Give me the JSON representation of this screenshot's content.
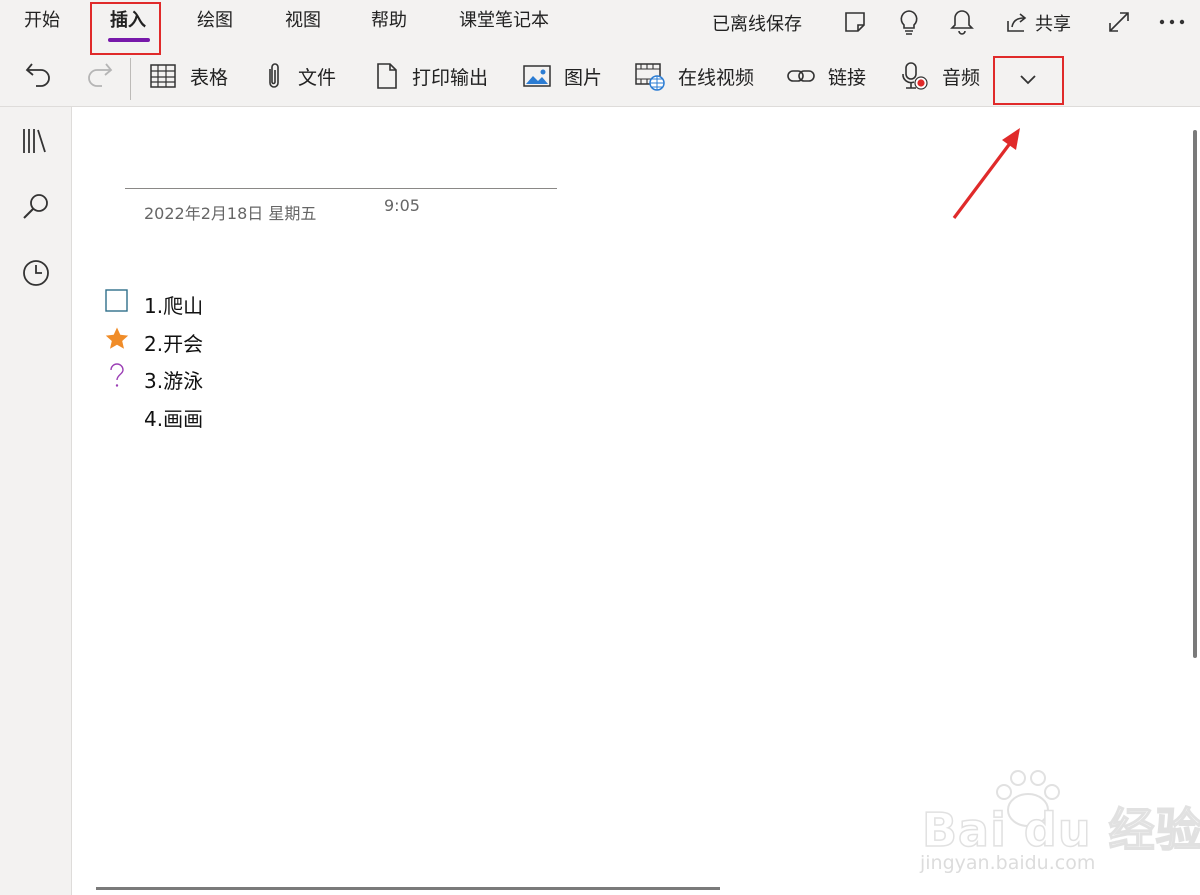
{
  "ribbon": {
    "tabs": [
      {
        "label": "开始"
      },
      {
        "label": "插入"
      },
      {
        "label": "绘图"
      },
      {
        "label": "视图"
      },
      {
        "label": "帮助"
      },
      {
        "label": "课堂笔记本"
      }
    ],
    "active_tab": "插入",
    "status_text": "已离线保存",
    "share_label": "共享",
    "tools": [
      {
        "label": "表格",
        "icon": "table-icon"
      },
      {
        "label": "文件",
        "icon": "paperclip-icon"
      },
      {
        "label": "打印输出",
        "icon": "document-icon"
      },
      {
        "label": "图片",
        "icon": "picture-icon"
      },
      {
        "label": "在线视频",
        "icon": "online-video-icon"
      },
      {
        "label": "链接",
        "icon": "link-icon"
      },
      {
        "label": "音频",
        "icon": "microphone-record-icon"
      }
    ],
    "accent_color": "#7719aa",
    "highlight_color": "#e02a2a"
  },
  "sidebar": {
    "icons": [
      "notebooks-icon",
      "search-icon",
      "recent-icon"
    ]
  },
  "page": {
    "date": "2022年2月18日 星期五",
    "time": "9:05",
    "items": [
      {
        "text": "1.爬山",
        "tag": "todo-checkbox-icon"
      },
      {
        "text": "2.开会",
        "tag": "star-icon"
      },
      {
        "text": "3.游泳",
        "tag": "question-icon"
      },
      {
        "text": "4.画画",
        "tag": ""
      }
    ]
  },
  "watermark": {
    "brand": "Bai du 经验",
    "url": "jingyan.baidu.com"
  }
}
